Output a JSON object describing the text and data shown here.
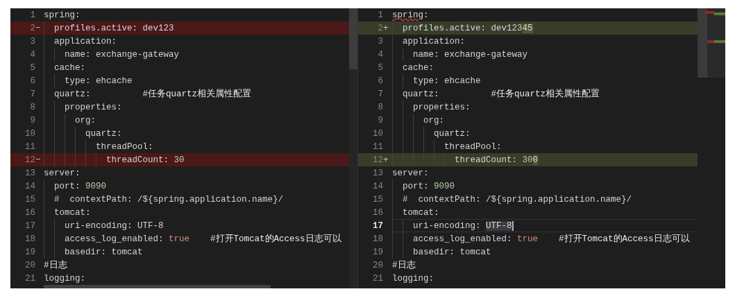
{
  "panes": [
    {
      "lines": [
        {
          "number": "1",
          "kind": "plain",
          "segments": [
            {
              "text": "spring:",
              "kind": "key"
            }
          ]
        },
        {
          "number": "2",
          "kind": "removed",
          "marker": "−",
          "segments": [
            {
              "text": "  profiles.active: dev123",
              "kind": "key"
            }
          ]
        },
        {
          "number": "3",
          "kind": "plain",
          "segments": [
            {
              "text": "  application:",
              "kind": "key"
            }
          ]
        },
        {
          "number": "4",
          "kind": "plain",
          "segments": [
            {
              "text": "    name: exchange-gateway",
              "kind": "key"
            }
          ]
        },
        {
          "number": "5",
          "kind": "plain",
          "segments": [
            {
              "text": "  cache:",
              "kind": "key"
            }
          ]
        },
        {
          "number": "6",
          "kind": "plain",
          "segments": [
            {
              "text": "    type: ehcache",
              "kind": "key"
            }
          ]
        },
        {
          "number": "7",
          "kind": "plain",
          "segments": [
            {
              "text": "  quartz:          ",
              "kind": "key"
            },
            {
              "text": "#任务quartz相关属性配置",
              "kind": "comment"
            }
          ]
        },
        {
          "number": "8",
          "kind": "plain",
          "segments": [
            {
              "text": "    properties:",
              "kind": "key"
            }
          ]
        },
        {
          "number": "9",
          "kind": "plain",
          "segments": [
            {
              "text": "      org:",
              "kind": "key"
            }
          ]
        },
        {
          "number": "10",
          "kind": "plain",
          "segments": [
            {
              "text": "        quartz:",
              "kind": "key"
            }
          ]
        },
        {
          "number": "11",
          "kind": "plain",
          "segments": [
            {
              "text": "          threadPool:",
              "kind": "key"
            }
          ]
        },
        {
          "number": "12",
          "kind": "removed",
          "marker": "−",
          "segments": [
            {
              "text": "            threadCount: ",
              "kind": "key"
            },
            {
              "text": "30",
              "kind": "number"
            }
          ]
        },
        {
          "number": "13",
          "kind": "plain",
          "segments": [
            {
              "text": "server:",
              "kind": "key"
            }
          ]
        },
        {
          "number": "14",
          "kind": "plain",
          "segments": [
            {
              "text": "  port: ",
              "kind": "key"
            },
            {
              "text": "9090",
              "kind": "number"
            }
          ]
        },
        {
          "number": "15",
          "kind": "plain",
          "segments": [
            {
              "text": "  #  contextPath: /${spring.application.name}/",
              "kind": "key"
            }
          ]
        },
        {
          "number": "16",
          "kind": "plain",
          "segments": [
            {
              "text": "  tomcat:",
              "kind": "key"
            }
          ]
        },
        {
          "number": "17",
          "kind": "plain",
          "segments": [
            {
              "text": "    uri-encoding: UTF-8",
              "kind": "key"
            }
          ]
        },
        {
          "number": "18",
          "kind": "plain",
          "segments": [
            {
              "text": "    access_log_enabled: ",
              "kind": "key"
            },
            {
              "text": "true",
              "kind": "bool"
            },
            {
              "text": "    #打开Tomcat的Access日志可以",
              "kind": "comment"
            }
          ]
        },
        {
          "number": "19",
          "kind": "plain",
          "segments": [
            {
              "text": "    basedir: tomcat",
              "kind": "key"
            }
          ]
        },
        {
          "number": "20",
          "kind": "plain",
          "segments": [
            {
              "text": "#日志",
              "kind": "comment"
            }
          ]
        },
        {
          "number": "21",
          "kind": "plain",
          "segments": [
            {
              "text": "logging:",
              "kind": "key"
            }
          ]
        }
      ]
    },
    {
      "lines": [
        {
          "number": "1",
          "kind": "plain",
          "segments": [
            {
              "text": "spring",
              "kind": "squiggle"
            },
            {
              "text": ":",
              "kind": "key"
            }
          ]
        },
        {
          "number": "2",
          "kind": "added",
          "marker": "+",
          "segments": [
            {
              "text": "  profiles.active: dev123",
              "kind": "key"
            },
            {
              "text": "45",
              "kind": "inserted"
            }
          ]
        },
        {
          "number": "3",
          "kind": "plain",
          "segments": [
            {
              "text": "  application:",
              "kind": "key"
            }
          ]
        },
        {
          "number": "4",
          "kind": "plain",
          "segments": [
            {
              "text": "    name: exchange-gateway",
              "kind": "key"
            }
          ]
        },
        {
          "number": "5",
          "kind": "plain",
          "segments": [
            {
              "text": "  cache:",
              "kind": "key"
            }
          ]
        },
        {
          "number": "6",
          "kind": "plain",
          "segments": [
            {
              "text": "    type: ehcache",
              "kind": "key"
            }
          ]
        },
        {
          "number": "7",
          "kind": "plain",
          "segments": [
            {
              "text": "  quartz:          ",
              "kind": "key"
            },
            {
              "text": "#任务quartz相关属性配置",
              "kind": "comment"
            }
          ]
        },
        {
          "number": "8",
          "kind": "plain",
          "segments": [
            {
              "text": "    properties:",
              "kind": "key"
            }
          ]
        },
        {
          "number": "9",
          "kind": "plain",
          "segments": [
            {
              "text": "      org:",
              "kind": "key"
            }
          ]
        },
        {
          "number": "10",
          "kind": "plain",
          "segments": [
            {
              "text": "        quartz:",
              "kind": "key"
            }
          ]
        },
        {
          "number": "11",
          "kind": "plain",
          "segments": [
            {
              "text": "          threadPool:",
              "kind": "key"
            }
          ]
        },
        {
          "number": "12",
          "kind": "added",
          "marker": "+",
          "segments": [
            {
              "text": "            threadCount: ",
              "kind": "key"
            },
            {
              "text": "30",
              "kind": "number"
            },
            {
              "text": "0",
              "kind": "inserted"
            }
          ]
        },
        {
          "number": "13",
          "kind": "plain",
          "segments": [
            {
              "text": "server:",
              "kind": "key"
            }
          ]
        },
        {
          "number": "14",
          "kind": "plain",
          "segments": [
            {
              "text": "  port: ",
              "kind": "key"
            },
            {
              "text": "9090",
              "kind": "number"
            }
          ]
        },
        {
          "number": "15",
          "kind": "plain",
          "segments": [
            {
              "text": "  #  contextPath: /${spring.application.name}/",
              "kind": "key"
            }
          ]
        },
        {
          "number": "16",
          "kind": "plain",
          "segments": [
            {
              "text": "  tomcat:",
              "kind": "key"
            }
          ]
        },
        {
          "number": "17",
          "kind": "plain",
          "current": true,
          "segments": [
            {
              "text": "    uri-encoding: ",
              "kind": "key"
            },
            {
              "text": "UTF-8",
              "kind": "selected"
            }
          ]
        },
        {
          "number": "18",
          "kind": "plain",
          "segments": [
            {
              "text": "    access_log_enabled: ",
              "kind": "key"
            },
            {
              "text": "true",
              "kind": "bool"
            },
            {
              "text": "    #打开Tomcat的Access日志可以",
              "kind": "comment"
            }
          ]
        },
        {
          "number": "19",
          "kind": "plain",
          "segments": [
            {
              "text": "    basedir: tomcat",
              "kind": "key"
            }
          ]
        },
        {
          "number": "20",
          "kind": "plain",
          "segments": [
            {
              "text": "#日志",
              "kind": "comment"
            }
          ]
        },
        {
          "number": "21",
          "kind": "plain",
          "segments": [
            {
              "text": "logging:",
              "kind": "key"
            }
          ]
        }
      ]
    }
  ]
}
